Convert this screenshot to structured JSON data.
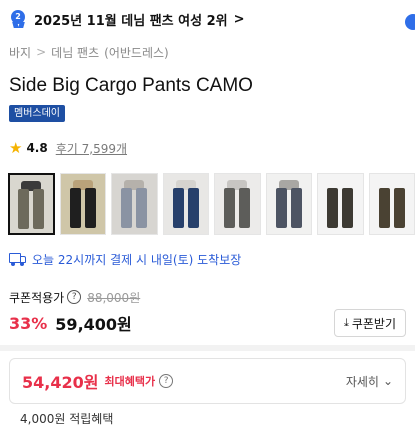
{
  "ranking": {
    "text": "2025년 11월 데님 팬츠 여성 2위",
    "medal_number": "2",
    "chevron": ">"
  },
  "breadcrumb": [
    "바지",
    "데님 팬츠",
    "(어반드레스)"
  ],
  "breadcrumb_separator": ">",
  "product": {
    "title": "Side Big Cargo Pants CAMO",
    "badge": "멤버스데이"
  },
  "rating": {
    "score": "4.8",
    "reviews": "후기 7,599개"
  },
  "thumbnails": [
    {
      "name": "thumb-1",
      "bg": "#d9d7cf",
      "pants": "#6d6a5c",
      "top": "#3a3a3a",
      "selected": true
    },
    {
      "name": "thumb-2",
      "bg": "#cfc6a8",
      "pants": "#1f1f1f",
      "top": "#b9a27a",
      "selected": false
    },
    {
      "name": "thumb-3",
      "bg": "#d7d5d1",
      "pants": "#8a93a3",
      "top": "#b5b1ab",
      "selected": false
    },
    {
      "name": "thumb-4",
      "bg": "#e8e7e5",
      "pants": "#27406b",
      "top": "#d5d3cf",
      "selected": false
    },
    {
      "name": "thumb-5",
      "bg": "#ecebea",
      "pants": "#5d5d5a",
      "top": "#c7c5c2",
      "selected": false
    },
    {
      "name": "thumb-6",
      "bg": "#f1f1f0",
      "pants": "#4d5463",
      "top": "#a9a7a3",
      "selected": false
    },
    {
      "name": "thumb-7",
      "bg": "#f4f4f4",
      "pants": "#3d3a33",
      "top": "#f4f4f4",
      "selected": false
    },
    {
      "name": "thumb-8",
      "bg": "#f4f4f4",
      "pants": "#4a4233",
      "top": "#f4f4f4",
      "selected": false
    }
  ],
  "delivery": {
    "text": "오늘 22시까지 결제 시 내일(토) 도착보장"
  },
  "pricing": {
    "coupon_label": "쿠폰적용가",
    "info_glyph": "?",
    "original_price": "88,000원",
    "discount_rate": "33%",
    "final_price": "59,400원",
    "coupon_button": "쿠폰받기",
    "coupon_button_icon": "⤓"
  },
  "max_benefit": {
    "amount": "54,420원",
    "label": "최대혜택가",
    "info_glyph": "?",
    "detail_label": "자세히",
    "detail_icon": "⌄"
  },
  "cut_off_text": "4,000원 적립혜택",
  "colors": {
    "accent_blue": "#2a5bd7",
    "badge_bg": "#1e4fa3",
    "discount_red": "#e8304a",
    "star_yellow": "#f5b301"
  }
}
